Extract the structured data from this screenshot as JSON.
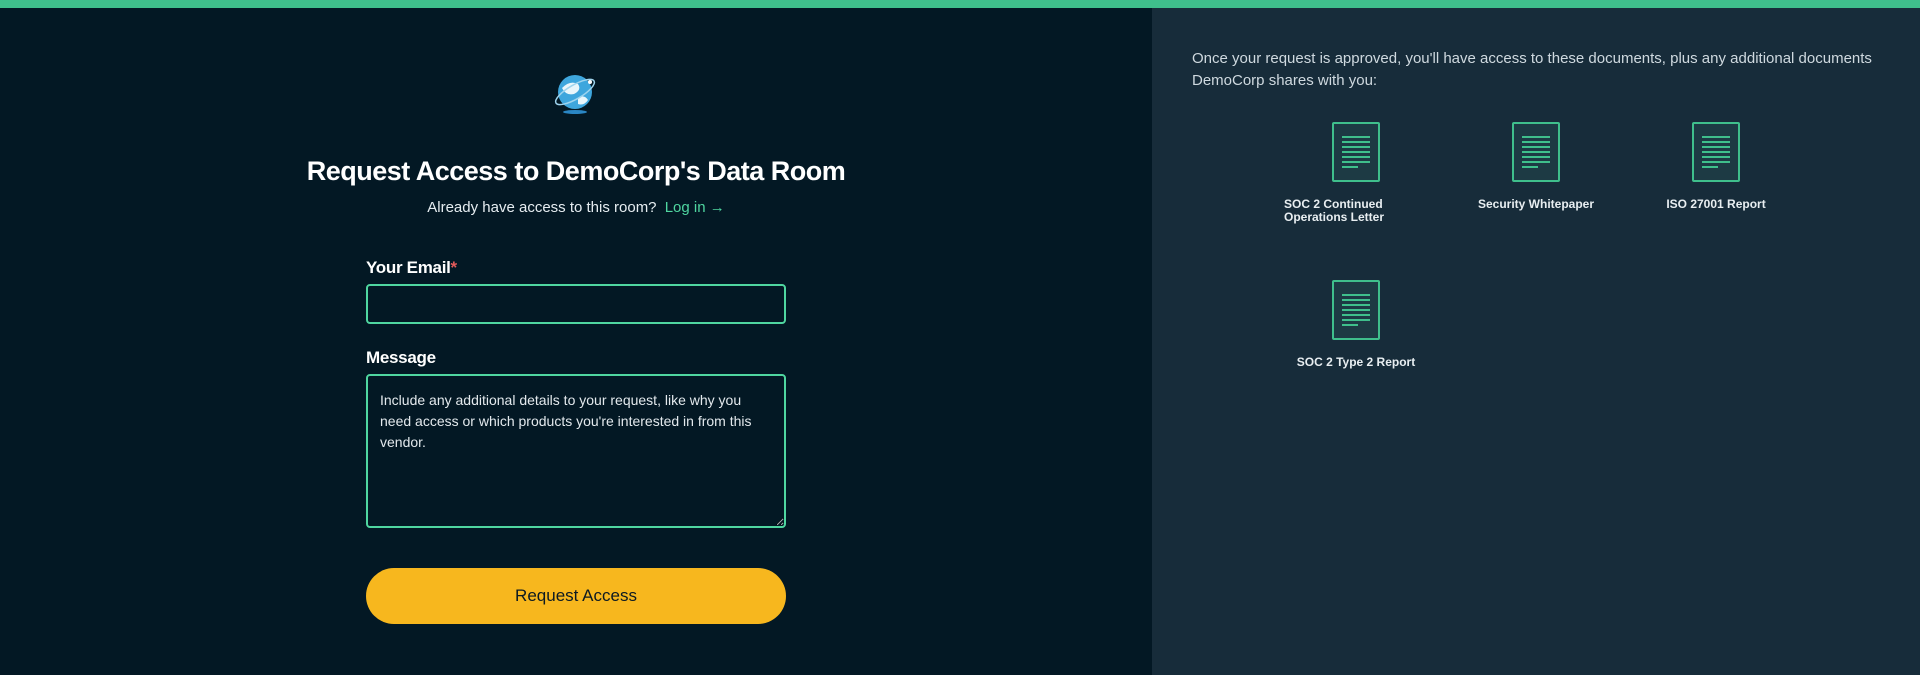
{
  "colors": {
    "accent": "#4fd6a0",
    "top_bar": "#3fbf8c",
    "button": "#f7b71e",
    "left_bg": "#031824",
    "right_bg": "#172c3a",
    "required": "#e45b5b"
  },
  "header": {
    "title": "Request Access to DemoCorp's Data Room",
    "already_text": "Already have access to this room?",
    "login_link": "Log in →"
  },
  "form": {
    "email_label": "Your Email",
    "required_mark": "*",
    "email_value": "",
    "message_label": "Message",
    "message_placeholder": "Include any additional details to your request, like why you need access or which products you're interested in from this vendor.",
    "submit_label": "Request Access"
  },
  "sidebar": {
    "info": "Once your request is approved, you'll have access to these documents, plus any additional documents DemoCorp shares with you:",
    "documents": [
      {
        "label": "SOC 2 Continued Operations Letter",
        "icon": "document-icon"
      },
      {
        "label": "Security Whitepaper",
        "icon": "document-icon"
      },
      {
        "label": "ISO 27001 Report",
        "icon": "document-icon"
      },
      {
        "label": "SOC 2 Type 2 Report",
        "icon": "document-icon"
      }
    ]
  }
}
